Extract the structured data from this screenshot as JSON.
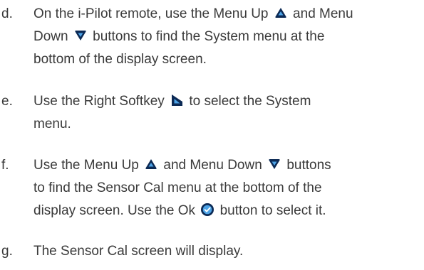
{
  "steps": [
    {
      "letter": "d.",
      "lines": [
        [
          "On the i-Pilot remote, use the Menu Up ",
          {
            "icon": "menu-up-icon"
          },
          " and Menu"
        ],
        [
          "Down ",
          {
            "icon": "menu-down-icon"
          },
          " buttons to find the System menu at the"
        ],
        [
          "bottom of the display screen."
        ]
      ]
    },
    {
      "letter": "e.",
      "lines": [
        [
          "Use the Right Softkey ",
          {
            "icon": "right-softkey-icon"
          },
          " to select the System"
        ],
        [
          "menu."
        ]
      ]
    },
    {
      "letter": "f.",
      "lines": [
        [
          "Use the Menu Up ",
          {
            "icon": "menu-up-icon"
          },
          " and Menu Down ",
          {
            "icon": "menu-down-icon"
          },
          " buttons"
        ],
        [
          "to find the Sensor Cal menu at the bottom of the"
        ],
        [
          "display screen. Use the Ok ",
          {
            "icon": "ok-check-icon"
          },
          " button to select it."
        ]
      ]
    },
    {
      "letter": "g.",
      "lines": [
        [
          "The Sensor Cal screen will display."
        ]
      ]
    }
  ],
  "colors": {
    "text": "#3a3a3a",
    "icon_fill": "#0c2a55",
    "icon_accent": "#4da3e6"
  }
}
